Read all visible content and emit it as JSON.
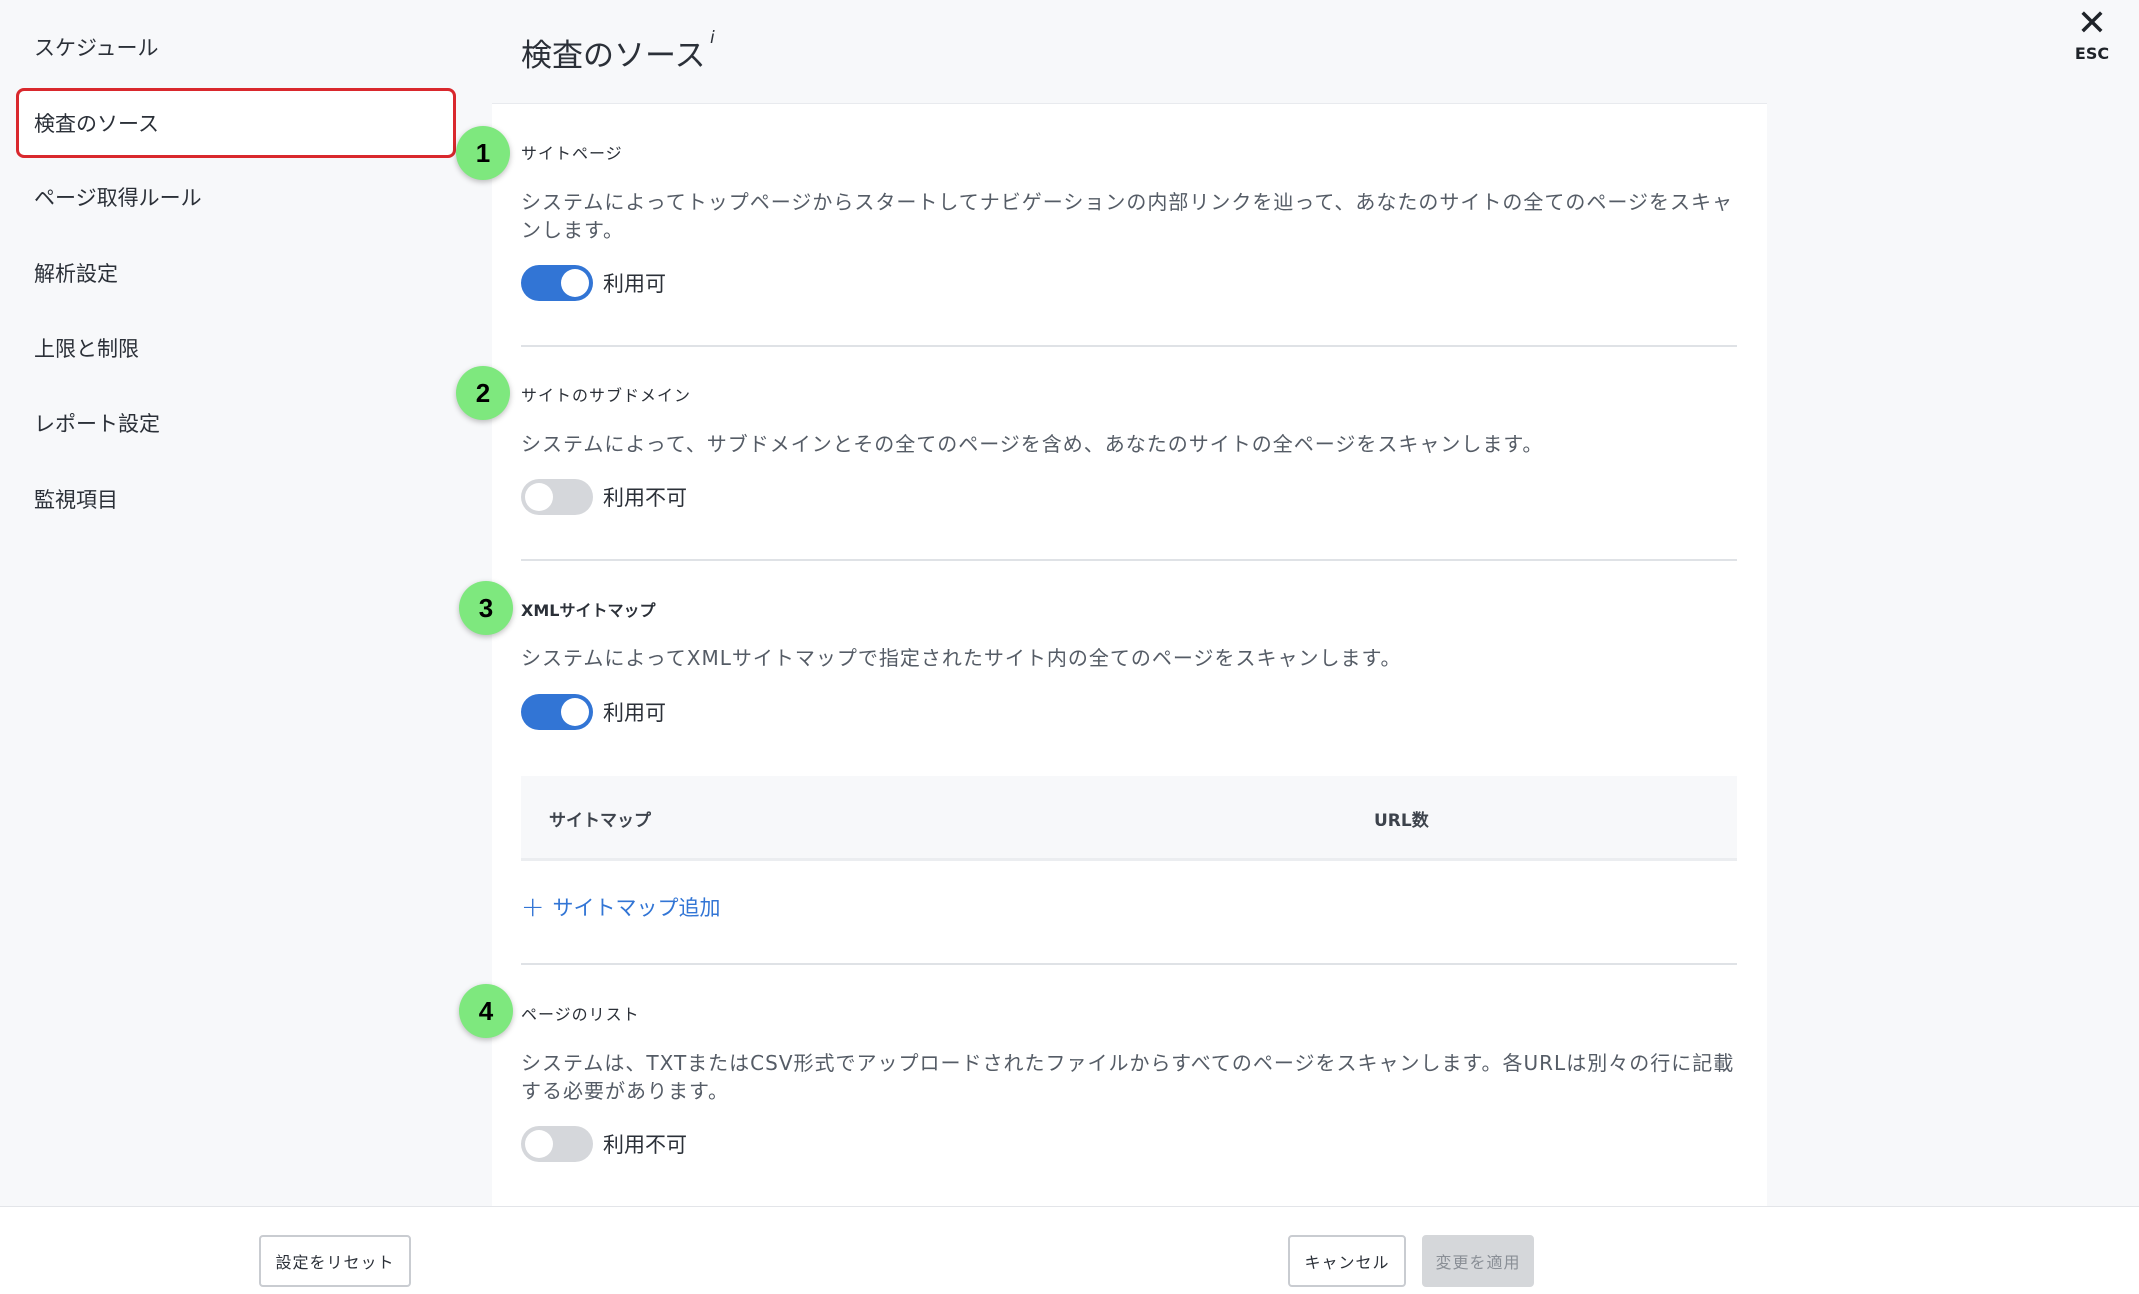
{
  "sidebar": {
    "items": [
      {
        "label": "スケジュール"
      },
      {
        "label": "検査のソース"
      },
      {
        "label": "ページ取得ルール"
      },
      {
        "label": "解析設定"
      },
      {
        "label": "上限と制限"
      },
      {
        "label": "レポート設定"
      },
      {
        "label": "監視項目"
      }
    ]
  },
  "header": {
    "title": "検査のソース",
    "info": "i",
    "close_icon": "close-icon",
    "esc_label": "ESC"
  },
  "sections": [
    {
      "badge": "1",
      "title": "サイトページ",
      "description": "システムによってトップページからスタートしてナビゲーションの内部リンクを辿って、あなたのサイトの全てのページをスキャンします。",
      "toggle_state": "on",
      "toggle_label": "利用可"
    },
    {
      "badge": "2",
      "title": "サイトのサブドメイン",
      "description": "システムによって、サブドメインとその全てのページを含め、あなたのサイトの全ページをスキャンします。",
      "toggle_state": "off",
      "toggle_label": "利用不可"
    },
    {
      "badge": "3",
      "title": "XMLサイトマップ",
      "description": "システムによってXMLサイトマップで指定されたサイト内の全てのページをスキャンします。",
      "toggle_state": "on",
      "toggle_label": "利用可"
    },
    {
      "badge": "4",
      "title": "ページのリスト",
      "description": "システムは、TXTまたはCSV形式でアップロードされたファイルからすべてのページをスキャンします。各URLは別々の行に記載する必要があります。",
      "toggle_state": "off",
      "toggle_label": "利用不可"
    }
  ],
  "sitemap_table": {
    "columns": [
      "サイトマップ",
      "URL数"
    ],
    "add_label": "サイトマップ追加",
    "add_icon": "plus-icon"
  },
  "footer": {
    "reset_label": "設定をリセット",
    "cancel_label": "キャンセル",
    "apply_label": "変更を適用"
  },
  "colors": {
    "accent": "#3275d5",
    "active_border": "#d9282d",
    "badge": "#7ee87e"
  }
}
